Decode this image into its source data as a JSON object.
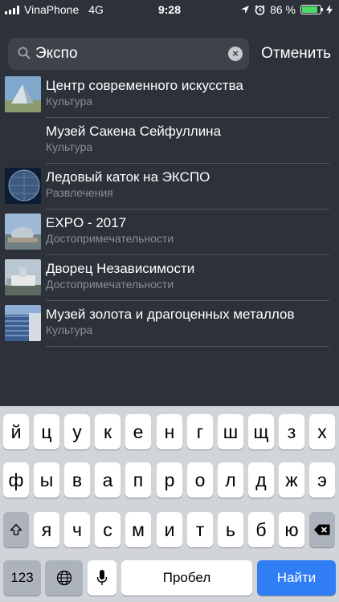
{
  "status_bar": {
    "carrier": "VinaPhone",
    "network": "4G",
    "time": "9:28",
    "battery_percent": "86 %",
    "battery_level": 0.86
  },
  "search": {
    "query": "Экспо",
    "cancel_label": "Отменить"
  },
  "results": [
    {
      "title": "Центр современного искусства",
      "category": "Культура",
      "thumb": "image-pyramid"
    },
    {
      "title": "Музей Сакена Сейфуллина",
      "category": "Культура",
      "thumb": null
    },
    {
      "title": "Ледовый каток на ЭКСПО",
      "category": "Развлечения",
      "thumb": "image-sphere"
    },
    {
      "title": "EXPO - 2017",
      "category": "Достопримечательности",
      "thumb": "image-expo"
    },
    {
      "title": "Дворец Независимости",
      "category": "Достопримечательности",
      "thumb": "image-palace"
    },
    {
      "title": "Музей золота и драгоценных металлов",
      "category": "Культура",
      "thumb": "image-museum"
    }
  ],
  "keyboard": {
    "row1": [
      "й",
      "ц",
      "у",
      "к",
      "е",
      "н",
      "г",
      "ш",
      "щ",
      "з",
      "х"
    ],
    "row2": [
      "ф",
      "ы",
      "в",
      "а",
      "п",
      "р",
      "о",
      "л",
      "д",
      "ж",
      "э"
    ],
    "row3": [
      "я",
      "ч",
      "с",
      "м",
      "и",
      "т",
      "ь",
      "б",
      "ю"
    ],
    "numbers_label": "123",
    "space_label": "Пробел",
    "go_label": "Найти"
  },
  "colors": {
    "background": "#2d323a",
    "accent": "#2f7ef4",
    "battery": "#4cd964"
  }
}
